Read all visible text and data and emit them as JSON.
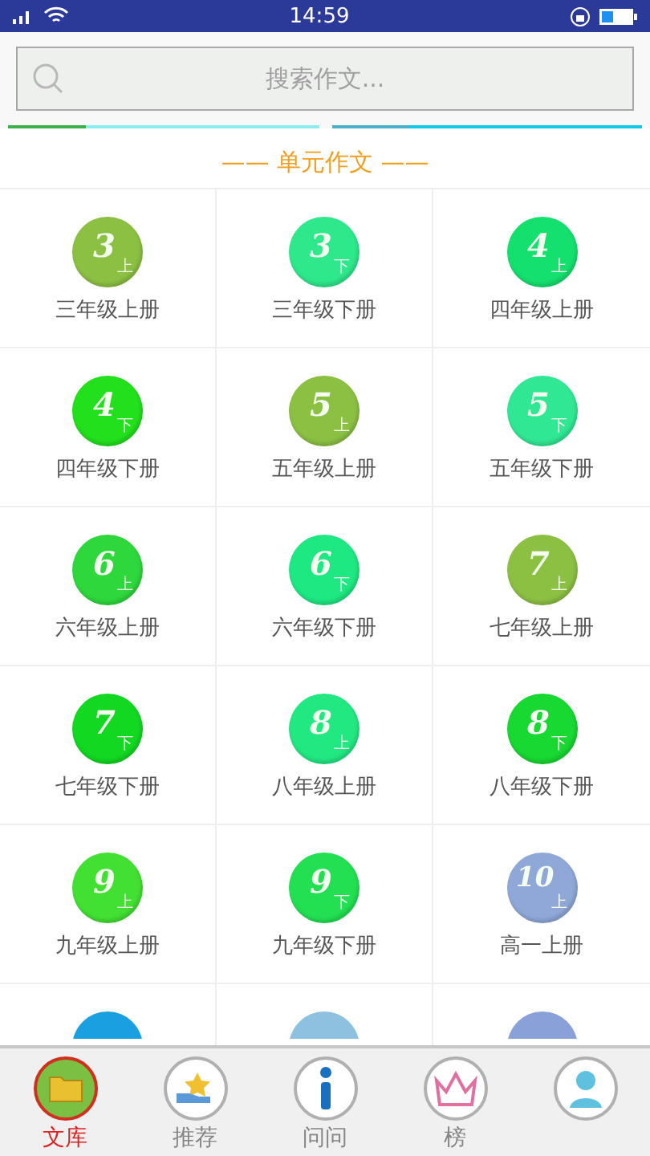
{
  "status_bar": {
    "time": "14:59"
  },
  "search": {
    "placeholder": "搜索作文..."
  },
  "tabs": [
    {
      "selected": true
    },
    {
      "selected": false
    }
  ],
  "section_title": "—— 单元作文 ——",
  "books": [
    {
      "number": "3",
      "half": "上",
      "label": "三年级上册",
      "color": "#8cc043"
    },
    {
      "number": "3",
      "half": "下",
      "label": "三年级下册",
      "color": "#2ee88c"
    },
    {
      "number": "4",
      "half": "上",
      "label": "四年级上册",
      "color": "#14e06e"
    },
    {
      "number": "4",
      "half": "下",
      "label": "四年级下册",
      "color": "#22e01c"
    },
    {
      "number": "5",
      "half": "上",
      "label": "五年级上册",
      "color": "#8cc043"
    },
    {
      "number": "5",
      "half": "下",
      "label": "五年级下册",
      "color": "#30e894"
    },
    {
      "number": "6",
      "half": "上",
      "label": "六年级上册",
      "color": "#2ed83c"
    },
    {
      "number": "6",
      "half": "下",
      "label": "六年级下册",
      "color": "#1ee882"
    },
    {
      "number": "7",
      "half": "上",
      "label": "七年级上册",
      "color": "#8cc043"
    },
    {
      "number": "7",
      "half": "下",
      "label": "七年级下册",
      "color": "#12d822"
    },
    {
      "number": "8",
      "half": "上",
      "label": "八年级上册",
      "color": "#22e882"
    },
    {
      "number": "8",
      "half": "下",
      "label": "八年级下册",
      "color": "#18d832"
    },
    {
      "number": "9",
      "half": "上",
      "label": "九年级上册",
      "color": "#42e032"
    },
    {
      "number": "9",
      "half": "下",
      "label": "九年级下册",
      "color": "#22e052"
    },
    {
      "number": "10",
      "half": "上",
      "label": "高一上册",
      "color": "#8fa8d8"
    },
    {
      "color": "#1aa0e0"
    },
    {
      "color": "#8ec0e0"
    },
    {
      "color": "#8aa0d8"
    }
  ],
  "nav": [
    {
      "kind": "folder",
      "label": "文库",
      "selected": true
    },
    {
      "kind": "star",
      "label": "推荐",
      "selected": false
    },
    {
      "kind": "info",
      "label": "问问",
      "selected": false
    },
    {
      "kind": "crown",
      "label": "榜",
      "selected": false
    },
    {
      "kind": "person",
      "selected": false
    }
  ]
}
